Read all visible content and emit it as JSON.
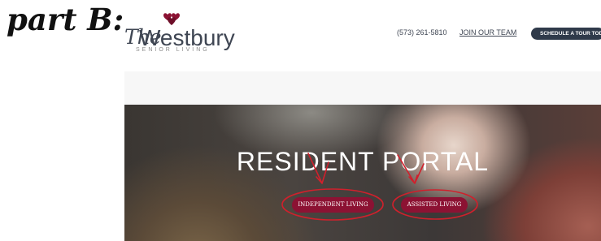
{
  "annotation": {
    "label": "part B:"
  },
  "logo": {
    "script": "The",
    "name": "Westbury",
    "tagline": "SENIOR LIVING"
  },
  "header": {
    "phone": "(573) 261-5810",
    "join_link": "JOIN OUR TEAM",
    "schedule_button": "SCHEDULE A TOUR TODAY"
  },
  "hero": {
    "title": "RESIDENT PORTAL",
    "buttons": [
      {
        "label": "INDEPENDENT LIVING"
      },
      {
        "label": "ASSISTED LIVING"
      }
    ]
  },
  "colors": {
    "brand_navy": "#2f3a4a",
    "brand_crimson": "#8c1233",
    "annotation_red": "#d0202c"
  }
}
